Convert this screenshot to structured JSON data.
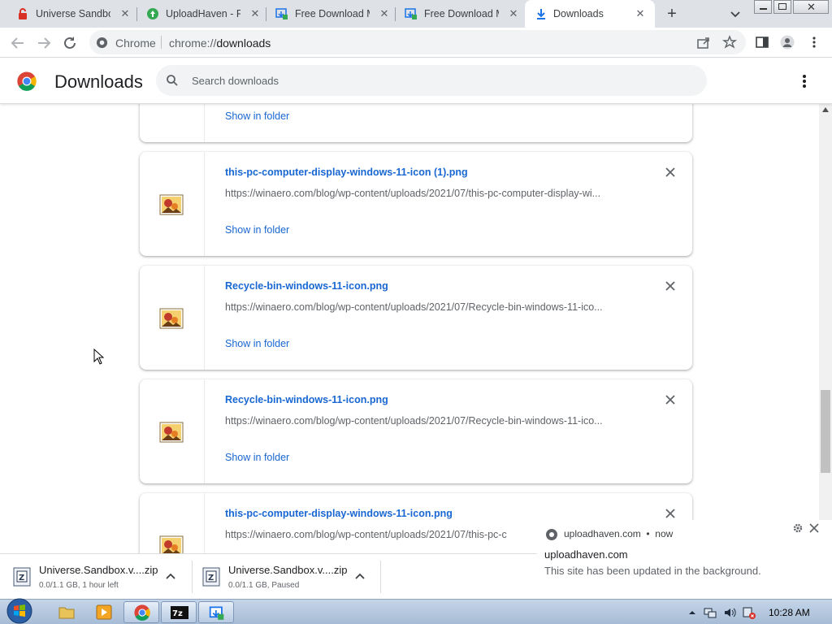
{
  "tabs": [
    {
      "title": "Universe Sandbox",
      "icon": "red-lock-icon"
    },
    {
      "title": "UploadHaven - Fi",
      "icon": "uploadhaven-icon"
    },
    {
      "title": "Free Download M",
      "icon": "fdm-icon"
    },
    {
      "title": "Free Download M",
      "icon": "fdm-icon"
    },
    {
      "title": "Downloads",
      "icon": "download-icon",
      "active": true
    }
  ],
  "omnibox": {
    "chrome_label": "Chrome",
    "scheme": "chrome://",
    "path": "downloads"
  },
  "header": {
    "title": "Downloads",
    "search_placeholder": "Search downloads"
  },
  "downloads": [
    {
      "name": "",
      "url": "",
      "show_in_folder": "Show in folder"
    },
    {
      "name": "this-pc-computer-display-windows-11-icon (1).png",
      "url": "https://winaero.com/blog/wp-content/uploads/2021/07/this-pc-computer-display-wi...",
      "show_in_folder": "Show in folder"
    },
    {
      "name": "Recycle-bin-windows-11-icon.png",
      "url": "https://winaero.com/blog/wp-content/uploads/2021/07/Recycle-bin-windows-11-ico...",
      "show_in_folder": "Show in folder"
    },
    {
      "name": "Recycle-bin-windows-11-icon.png",
      "url": "https://winaero.com/blog/wp-content/uploads/2021/07/Recycle-bin-windows-11-ico...",
      "show_in_folder": "Show in folder"
    },
    {
      "name": "this-pc-computer-display-windows-11-icon.png",
      "url": "https://winaero.com/blog/wp-content/uploads/2021/07/this-pc-c",
      "show_in_folder": ""
    }
  ],
  "shelf": [
    {
      "name": "Universe.Sandbox.v....zip",
      "status": "0.0/1.1 GB, 1 hour left"
    },
    {
      "name": "Universe.Sandbox.v....zip",
      "status": "0.0/1.1 GB, Paused"
    }
  ],
  "notification": {
    "source": "uploadhaven.com",
    "dot": "•",
    "time": "now",
    "title": "uploadhaven.com",
    "body": "This site has been updated in the background."
  },
  "taskbar": {
    "clock": "10:28 AM"
  },
  "colors": {
    "link": "#1967d2",
    "tabstrip": "#dee1e6",
    "taskbar": "#b7cae2"
  }
}
